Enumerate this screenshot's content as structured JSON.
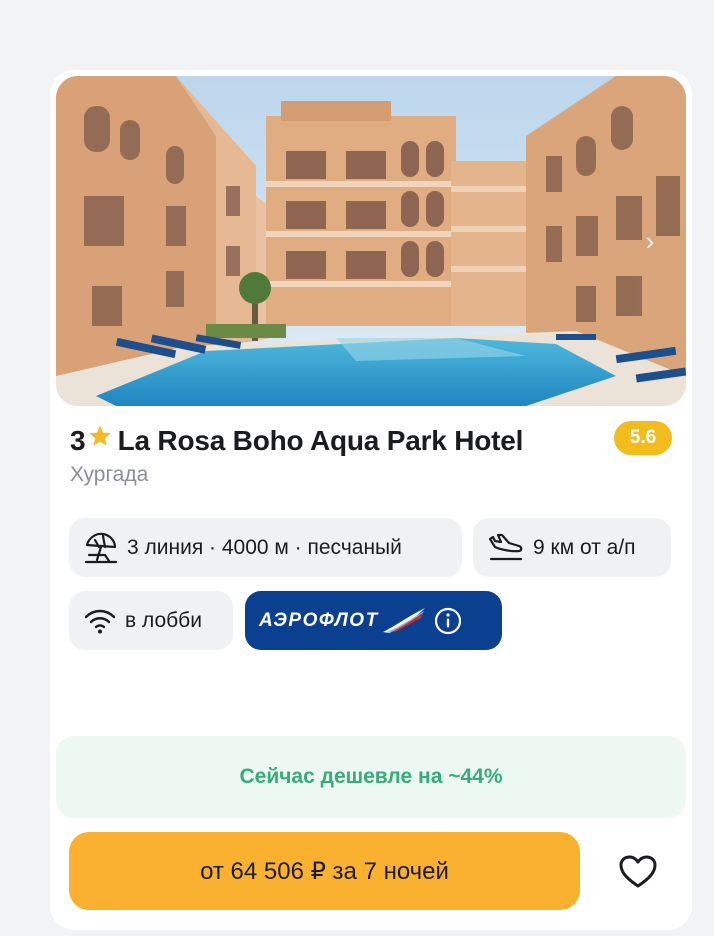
{
  "hotel": {
    "stars": "3",
    "name": "La Rosa Boho Aqua Park Hotel",
    "rating": "5.6",
    "city": "Хургада"
  },
  "chips": {
    "beach": "3 линия · 4000 м · песчаный",
    "airport": "9 км от а/п",
    "wifi": "в лобби"
  },
  "airline": {
    "name": "АЭРОФЛОТ"
  },
  "discount": {
    "text": "Сейчас дешевле на ~44%"
  },
  "price": {
    "button_label": "от 64 506 ₽ за 7 ночей"
  },
  "colors": {
    "accent": "#fbb130",
    "rating": "#f2bd1c",
    "discount_text": "#35ad7b",
    "airline_bg": "#0b3f8f"
  },
  "icons": [
    "star-icon",
    "beach-umbrella-icon",
    "plane-landing-icon",
    "wifi-icon",
    "info-icon",
    "heart-icon",
    "chevron-right-icon"
  ]
}
